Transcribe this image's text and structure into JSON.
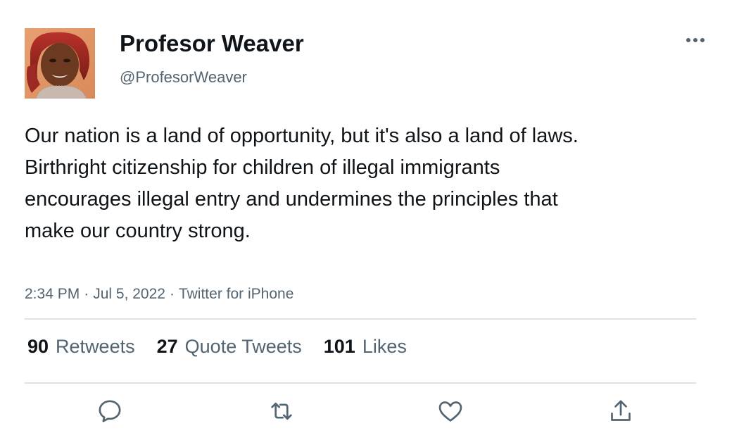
{
  "tweet": {
    "author": {
      "display_name": "Profesor Weaver",
      "handle": "@ProfesorWeaver"
    },
    "text": "Our nation is a land of opportunity, but it's also a land of laws. Birthright citizenship for children of illegal immigrants encourages illegal entry and undermines the principles that make our country strong.",
    "time": "2:34 PM",
    "date": "Jul 5, 2022",
    "source": "Twitter for iPhone",
    "separator": "·",
    "stats": {
      "retweets": {
        "count": "90",
        "label": "Retweets"
      },
      "quote_tweets": {
        "count": "27",
        "label": "Quote Tweets"
      },
      "likes": {
        "count": "101",
        "label": "Likes"
      }
    }
  },
  "icons": {
    "more": "more-horizontal-icon",
    "reply": "reply-icon",
    "retweet": "retweet-icon",
    "like": "heart-icon",
    "share": "share-icon"
  },
  "colors": {
    "text_primary": "#0f1419",
    "text_secondary": "#536471",
    "divider": "#dfe3e6"
  }
}
